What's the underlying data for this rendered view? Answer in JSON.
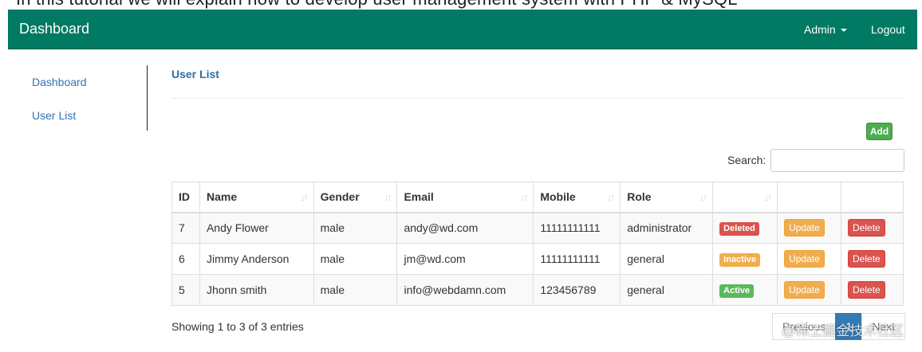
{
  "top_caption": "In this tutorial, we will explain how to develop a user management system with PHP and MySQL. We will cover...",
  "navbar": {
    "brand": "Dashboard",
    "admin_label": "Admin",
    "logout_label": "Logout",
    "color": "#007a62"
  },
  "sidebar": {
    "items": [
      {
        "label": "Dashboard"
      },
      {
        "label": "User List"
      }
    ]
  },
  "main": {
    "title": "User List",
    "add_label": "Add",
    "search_label": "Search:",
    "search_value": ""
  },
  "table": {
    "headers": [
      "ID",
      "Name",
      "Gender",
      "Email",
      "Mobile",
      "Role",
      "",
      "",
      ""
    ],
    "rows": [
      {
        "id": "7",
        "name": "Andy Flower",
        "gender": "male",
        "email": "andy@wd.com",
        "mobile": "11111111111",
        "role": "administrator",
        "status": "Deleted",
        "status_color": "#d9534f",
        "update": "Update",
        "delete": "Delete"
      },
      {
        "id": "6",
        "name": "Jimmy Anderson",
        "gender": "male",
        "email": "jm@wd.com",
        "mobile": "11111111111",
        "role": "general",
        "status": "Inactive",
        "status_color": "#f0ad4e",
        "update": "Update",
        "delete": "Delete"
      },
      {
        "id": "5",
        "name": "Jhonn smith",
        "gender": "male",
        "email": "info@webdamn.com",
        "mobile": "123456789",
        "role": "general",
        "status": "Active",
        "status_color": "#5cb85c",
        "update": "Update",
        "delete": "Delete"
      }
    ]
  },
  "footer": {
    "info": "Showing 1 to 3 of 3 entries",
    "pagination": {
      "previous": "Previous",
      "current": "1",
      "next": "Next"
    }
  },
  "watermark": "@稀土掘金技术社区",
  "colors": {
    "update_button": "#f0ad4e",
    "delete_button": "#d9534f",
    "add_button": "#4cae4c",
    "link": "#3572b0",
    "active_page": "#337ab7"
  }
}
